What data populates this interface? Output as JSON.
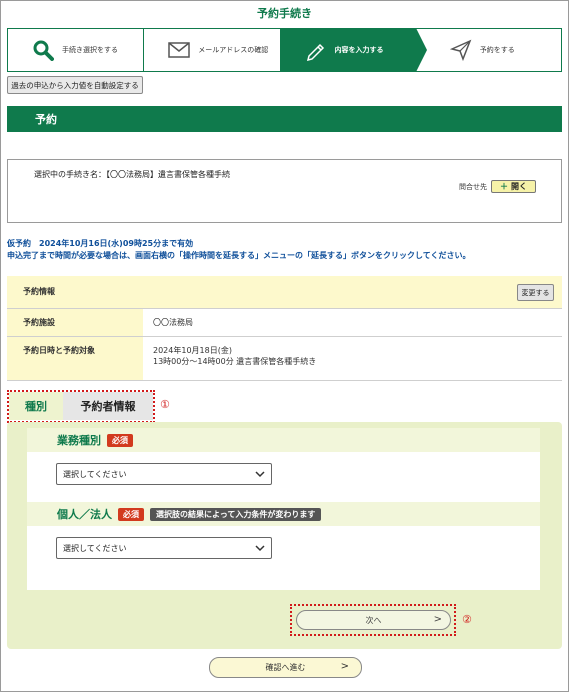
{
  "page": {
    "title": "予約手続き"
  },
  "steps": [
    {
      "label": "手続き選択をする",
      "icon": "search-icon"
    },
    {
      "label": "メールアドレスの確認",
      "icon": "envelope-icon"
    },
    {
      "label": "内容を入力する",
      "icon": "pen-icon",
      "active": true
    },
    {
      "label": "予約をする",
      "icon": "send-icon"
    }
  ],
  "autofill_button": "過去の申込から入力値を自動設定する",
  "section_title": "予約",
  "procedure": {
    "label": "選択中の手続き名：【〇〇法務局】遺言書保管各種手続",
    "contact_label": "問合せ先",
    "open_button": "開く"
  },
  "tentative": {
    "line1": "仮予約　2024年10月16日(水)09時25分まで有効",
    "line2": "申込完了まで時間が必要な場合は、画面右横の「操作時間を延長する」メニューの「延長する」ボタンをクリックしてください。"
  },
  "reservation_info": {
    "header": "予約情報",
    "change_button": "変更する",
    "facility_label": "予約施設",
    "facility_value": "〇〇法務局",
    "datetime_label": "予約日時と予約対象",
    "datetime_value_line1": "2024年10月18日(金)",
    "datetime_value_line2": "13時00分～14時00分 遺言書保管各種手続き"
  },
  "tabs": {
    "kind": "種別",
    "person": "予約者情報"
  },
  "annotations": {
    "one": "①",
    "two": "②"
  },
  "form": {
    "business_type_label": "業務種別",
    "required": "必須",
    "business_type_select": "選択してください",
    "person_type_label": "個人／法人",
    "person_type_note": "選択肢の結果によって入力条件が変わります",
    "person_type_select": "選択してください"
  },
  "next_button": "次へ",
  "confirm_button": "確認へ進む",
  "colors": {
    "accent": "#0f7a4c",
    "required": "#d23a1e",
    "highlight": "#fdf9cc",
    "form_bg": "#e9f0c9"
  }
}
